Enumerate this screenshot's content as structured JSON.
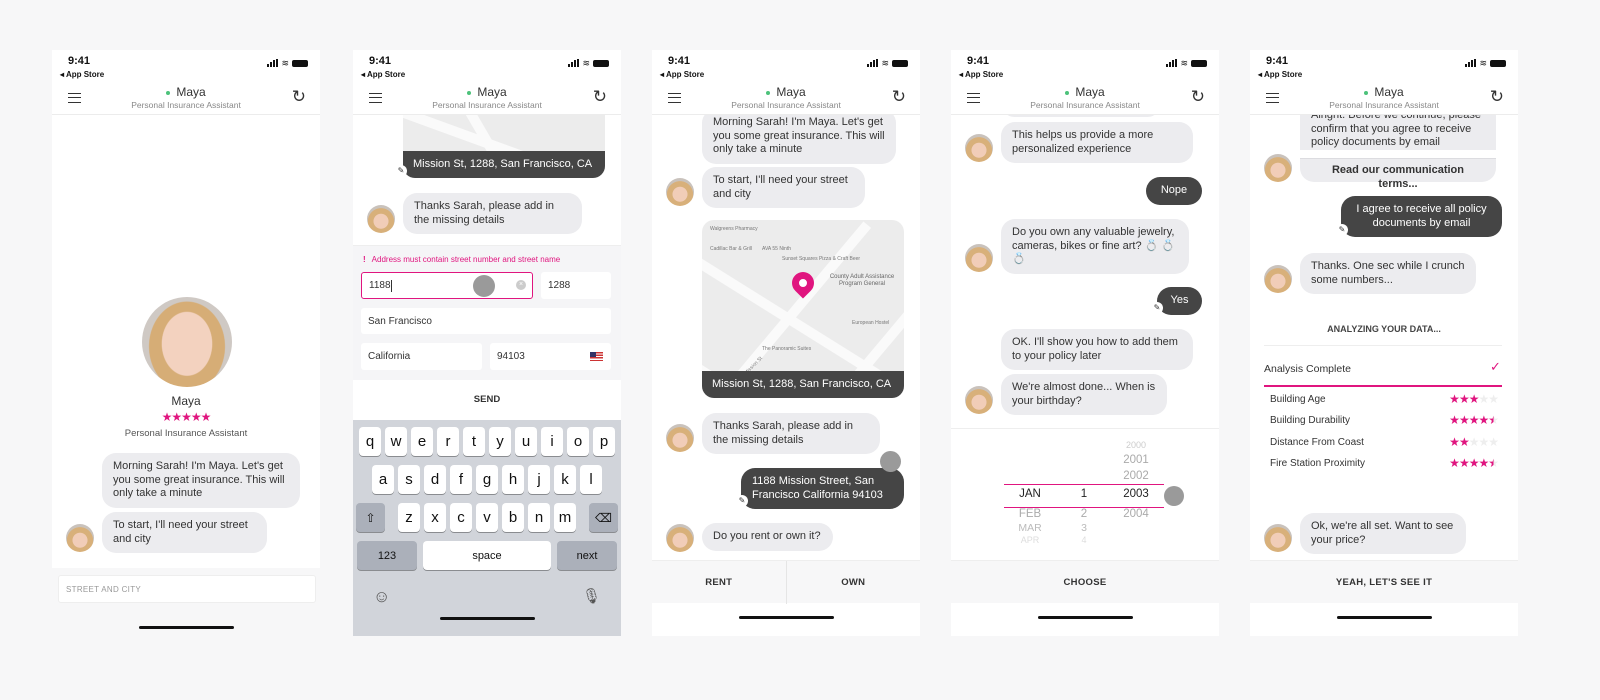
{
  "status": {
    "time": "9:41",
    "back": "◂ App Store"
  },
  "header": {
    "name": "Maya",
    "subtitle": "Personal Insurance Assistant"
  },
  "colors": {
    "accent": "#e0157f",
    "user_bubble": "#454545",
    "bot_bubble": "#ececef",
    "online": "#4cc27a"
  },
  "icons": {
    "menu": "hamburger-icon",
    "refresh": "refresh-icon",
    "edit": "pencil-icon",
    "check": "checkmark-icon",
    "clear": "clear-icon",
    "flag": "us-flag-icon",
    "emoji": "emoji-icon",
    "mic": "microphone-icon",
    "shift": "shift-icon",
    "delete": "backspace-icon"
  },
  "screen1": {
    "profile_name": "Maya",
    "rating": 5,
    "profile_role": "Personal Insurance Assistant",
    "messages": [
      "Morning Sarah! I'm Maya. Let's get you some great insurance. This will only take a minute",
      "To start, I'll need your street and city"
    ],
    "input_placeholder": "STREET AND CITY"
  },
  "screen2": {
    "map_address": "Mission St, 1288, San Francisco, CA",
    "message": "Thanks Sarah, please add in the missing details",
    "error": "Address must contain street number and street name",
    "fields": {
      "street": "1188",
      "number": "1288",
      "city": "San Francisco",
      "state": "California",
      "zip": "94103"
    },
    "send": "SEND",
    "keyboard": {
      "row1": [
        "q",
        "w",
        "e",
        "r",
        "t",
        "y",
        "u",
        "i",
        "o",
        "p"
      ],
      "row2": [
        "a",
        "s",
        "d",
        "f",
        "g",
        "h",
        "j",
        "k",
        "l"
      ],
      "row3": [
        "z",
        "x",
        "c",
        "v",
        "b",
        "n",
        "m"
      ],
      "numbers": "123",
      "space": "space",
      "next": "next"
    }
  },
  "screen3": {
    "messages": [
      "Morning Sarah! I'm Maya. Let's get you some great insurance. This will only take a minute",
      "To start, I'll need your street and city"
    ],
    "map_places": [
      "Walgreens Pharmacy",
      "Cadillac Bar & Grill",
      "AVA 55 Ninth",
      "Sunset Squares Pizza & Craft Beer",
      "County Adult Assistance Program General",
      "The Panoramic Suites",
      "European Hostel",
      "Mission St"
    ],
    "map_address": "Mission St, 1288, San Francisco, CA",
    "message2": "Thanks Sarah, please add in the missing details",
    "user_reply": "1188 Mission Street, San Francisco California 94103",
    "question": "Do you rent or own it?",
    "options": [
      "RENT",
      "OWN"
    ]
  },
  "screen4": {
    "messages": [
      {
        "from": "bot",
        "text": "This helps us provide a more personalized experience"
      },
      {
        "from": "user",
        "text": "Nope"
      },
      {
        "from": "bot",
        "text": "Do you own any valuable jewelry, cameras, bikes or fine art? 💍 💍 💍"
      },
      {
        "from": "user",
        "text": "Yes"
      },
      {
        "from": "bot",
        "text": "OK. I'll show you how to add them to your policy later"
      },
      {
        "from": "bot",
        "text": "We're almost done... When is your birthday?"
      }
    ],
    "picker": {
      "months": [
        "JAN",
        "FEB",
        "MAR",
        "APR"
      ],
      "days": [
        "1",
        "2",
        "3",
        "4"
      ],
      "years": [
        "2000",
        "2001",
        "2002",
        "2003",
        "2004"
      ],
      "selected": {
        "month": "JAN",
        "day": "1",
        "year": "2003"
      }
    },
    "choose": "CHOOSE"
  },
  "screen5": {
    "consent": "Alright. Before we continue, please confirm that you agree to receive policy documents by email",
    "terms_link": "Read our communication terms...",
    "user_reply": "I agree to receive all policy documents by email",
    "message": "Thanks. One sec while I crunch some numbers...",
    "analyzing": "ANALYZING YOUR DATA...",
    "complete": "Analysis Complete",
    "ratings": [
      {
        "label": "Building Age",
        "stars": 3
      },
      {
        "label": "Building Durability",
        "stars": 4.5
      },
      {
        "label": "Distance From Coast",
        "stars": 2
      },
      {
        "label": "Fire Station Proximity",
        "stars": 4.5
      }
    ],
    "final": "Ok, we're all set. Want to see your price?",
    "cta": "YEAH, LET'S SEE IT"
  }
}
